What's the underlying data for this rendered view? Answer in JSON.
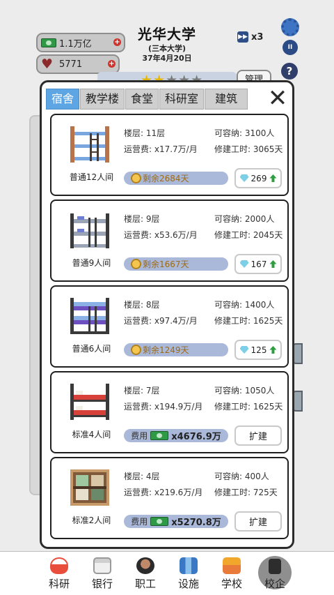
{
  "header": {
    "university_name": "光华大学",
    "university_tier": "(三本大学)",
    "date": "37年4月20日",
    "money": "1.1万亿",
    "reputation": "5771",
    "speed": "x3",
    "manage_label": "管理",
    "star_rating": 2
  },
  "tabs": [
    {
      "label": "宿舍",
      "active": true
    },
    {
      "label": "教学楼",
      "active": false
    },
    {
      "label": "食堂",
      "active": false
    },
    {
      "label": "科研室",
      "active": false
    },
    {
      "label": "建筑",
      "active": false
    }
  ],
  "labels": {
    "floors": "楼层: ",
    "capacity": "可容纳: ",
    "op_cost": "运营费: ",
    "build_time": "修建工时: ",
    "remaining_prefix": "剩余",
    "cost": "费用",
    "expand": "扩建"
  },
  "rooms": [
    {
      "name": "普通12人间",
      "floors": "11层",
      "capacity": "3100人",
      "op_cost": "x17.7万/月",
      "build_time": "3065天",
      "remaining": "剩余2684天",
      "gems": "269"
    },
    {
      "name": "普通9人间",
      "floors": "9层",
      "capacity": "2000人",
      "op_cost": "x53.6万/月",
      "build_time": "2045天",
      "remaining": "剩余1667天",
      "gems": "167"
    },
    {
      "name": "普通6人间",
      "floors": "8层",
      "capacity": "1400人",
      "op_cost": "x97.4万/月",
      "build_time": "1625天",
      "remaining": "剩余1249天",
      "gems": "125"
    },
    {
      "name": "标准4人间",
      "floors": "7层",
      "capacity": "1050人",
      "op_cost": "x194.9万/月",
      "build_time": "1625天",
      "cost_amount": "x4676.9万"
    },
    {
      "name": "标准2人间",
      "floors": "4层",
      "capacity": "400人",
      "op_cost": "x219.6万/月",
      "build_time": "725天",
      "cost_amount": "x5270.8万"
    }
  ],
  "nav": [
    {
      "label": "科研",
      "icon": "flask-icon"
    },
    {
      "label": "银行",
      "icon": "bank-icon"
    },
    {
      "label": "职工",
      "icon": "staff-icon"
    },
    {
      "label": "设施",
      "icon": "facility-icon"
    },
    {
      "label": "学校",
      "icon": "school-icon"
    },
    {
      "label": "校企",
      "icon": "lock-icon",
      "locked": true
    }
  ],
  "colors": {
    "tab_active": "#5ea5e4",
    "progress_bar": "#aab8d9",
    "up_arrow": "#2e9e3e",
    "plus_badge": "#d0332b"
  }
}
